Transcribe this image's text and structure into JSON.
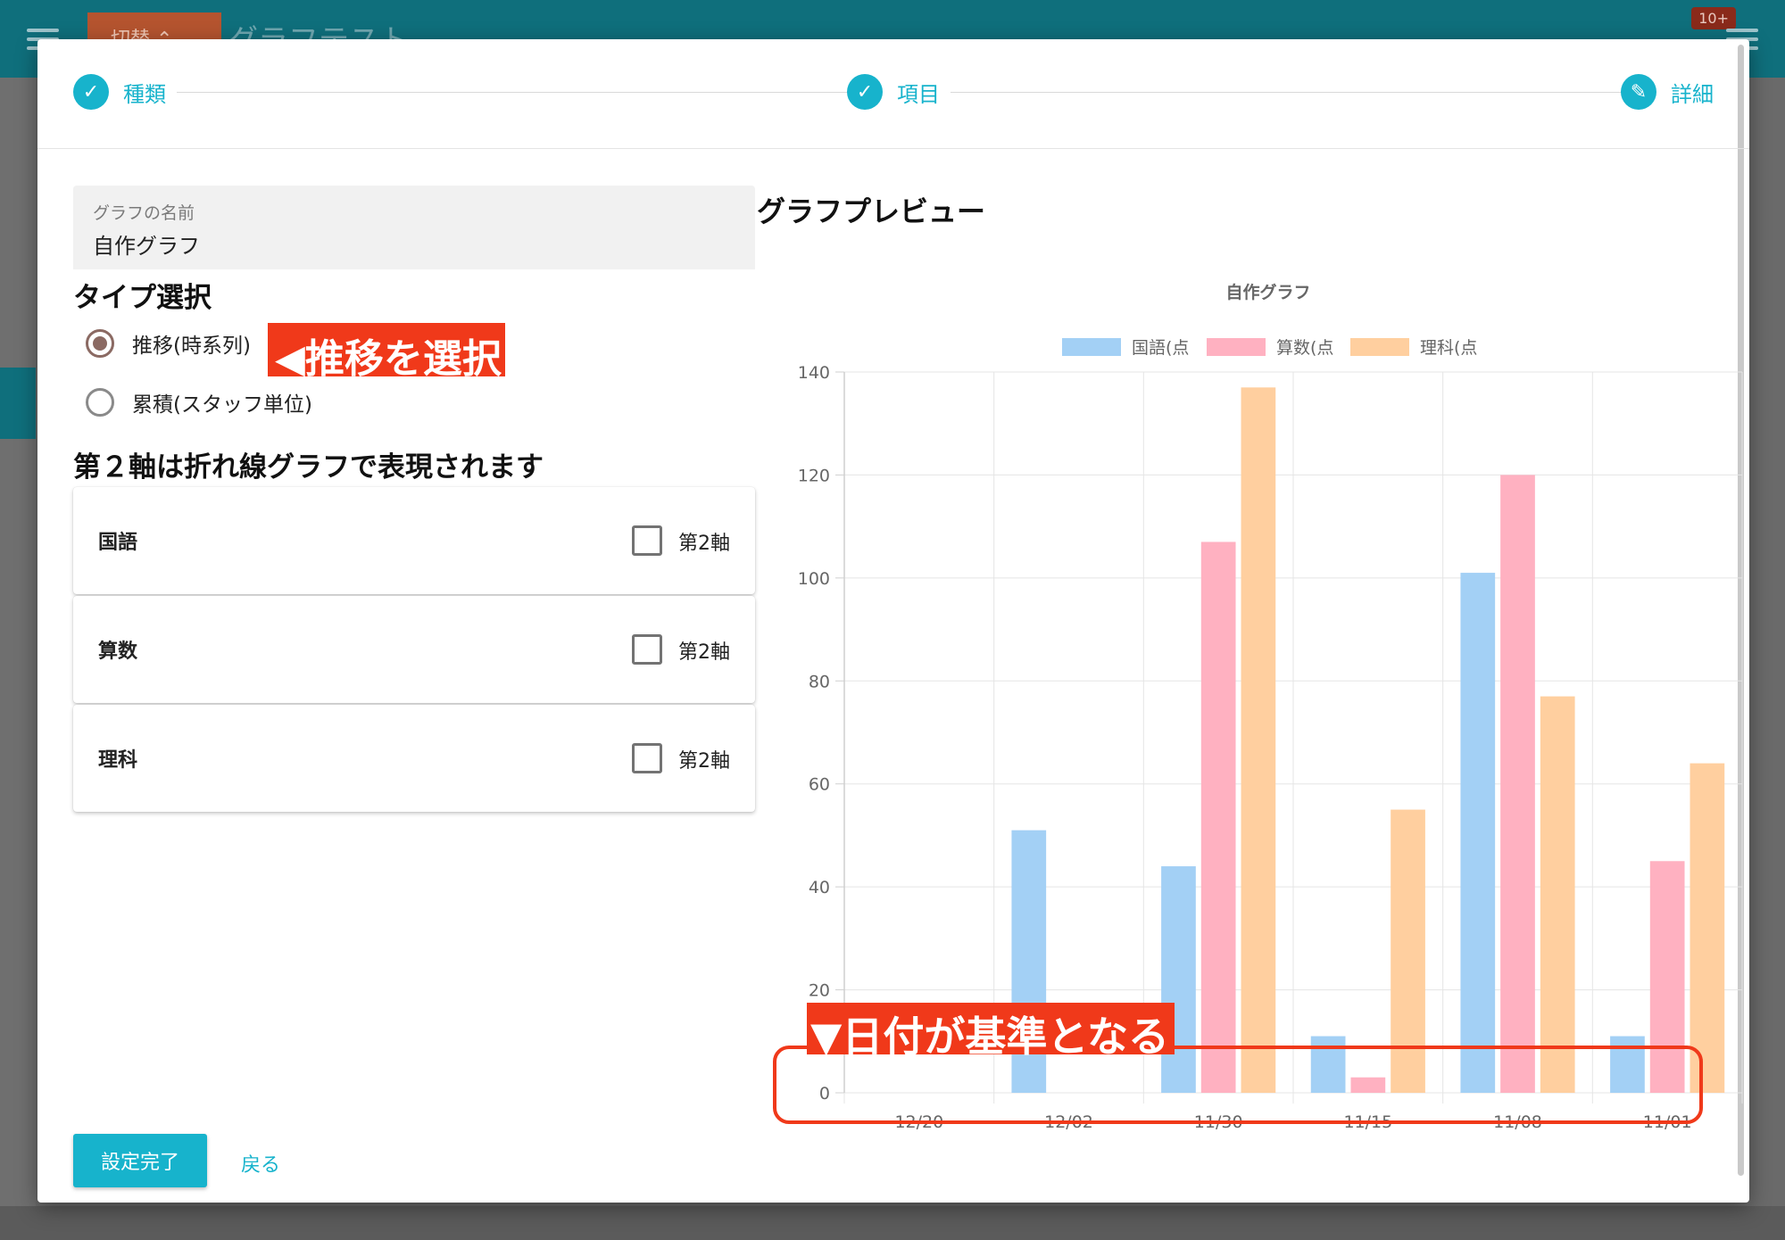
{
  "background_app": {
    "switch_label": "切替 ⌃",
    "title": "グラフテスト",
    "notification_badge": "10+"
  },
  "stepper": {
    "steps": [
      {
        "label": "種類",
        "icon": "check-icon",
        "glyph": "✓"
      },
      {
        "label": "項目",
        "icon": "check-icon",
        "glyph": "✓"
      },
      {
        "label": "詳細",
        "icon": "edit-pencil-icon",
        "glyph": "✎"
      }
    ]
  },
  "graph_name": {
    "label": "グラフの名前",
    "value": "自作グラフ"
  },
  "type_select": {
    "heading": "タイプ選択",
    "options": [
      {
        "label": "推移(時系列)",
        "selected": true
      },
      {
        "label": "累積(スタッフ単位)",
        "selected": false
      }
    ]
  },
  "annotations": {
    "select_trend": "◀推移を選択",
    "date_is_basis": "▼日付が基準となる"
  },
  "secondary_axis": {
    "heading": "第２軸は折れ線グラフで表現されます",
    "checkbox_label": "第2軸",
    "items": [
      {
        "name": "国語",
        "checked": false
      },
      {
        "name": "算数",
        "checked": false
      },
      {
        "name": "理科",
        "checked": false
      }
    ]
  },
  "actions": {
    "done_label": "設定完了",
    "back_label": "戻る"
  },
  "preview": {
    "heading": "グラフプレビュー"
  },
  "chart_data": {
    "type": "bar",
    "title": "自作グラフ",
    "categories": [
      "12/20",
      "12/02",
      "11/30",
      "11/15",
      "11/08",
      "11/01"
    ],
    "series": [
      {
        "name": "国語(点",
        "color": "#a3d0f5",
        "values": [
          0,
          51,
          44,
          11,
          101,
          11
        ]
      },
      {
        "name": "算数(点",
        "color": "#ffb1c1",
        "values": [
          0,
          0,
          107,
          3,
          120,
          45
        ]
      },
      {
        "name": "理科(点",
        "color": "#ffcf9f",
        "values": [
          0,
          0,
          137,
          55,
          77,
          64
        ]
      }
    ],
    "yticks": [
      "0",
      "20",
      "40",
      "60",
      "80",
      "100",
      "120",
      "140"
    ],
    "ylim": [
      0,
      140
    ],
    "grid": true,
    "legend_position": "top"
  },
  "colors": {
    "accent": "#17b3cc",
    "annotation_red": "#f0391a",
    "radio_selected": "#8b6a63"
  }
}
